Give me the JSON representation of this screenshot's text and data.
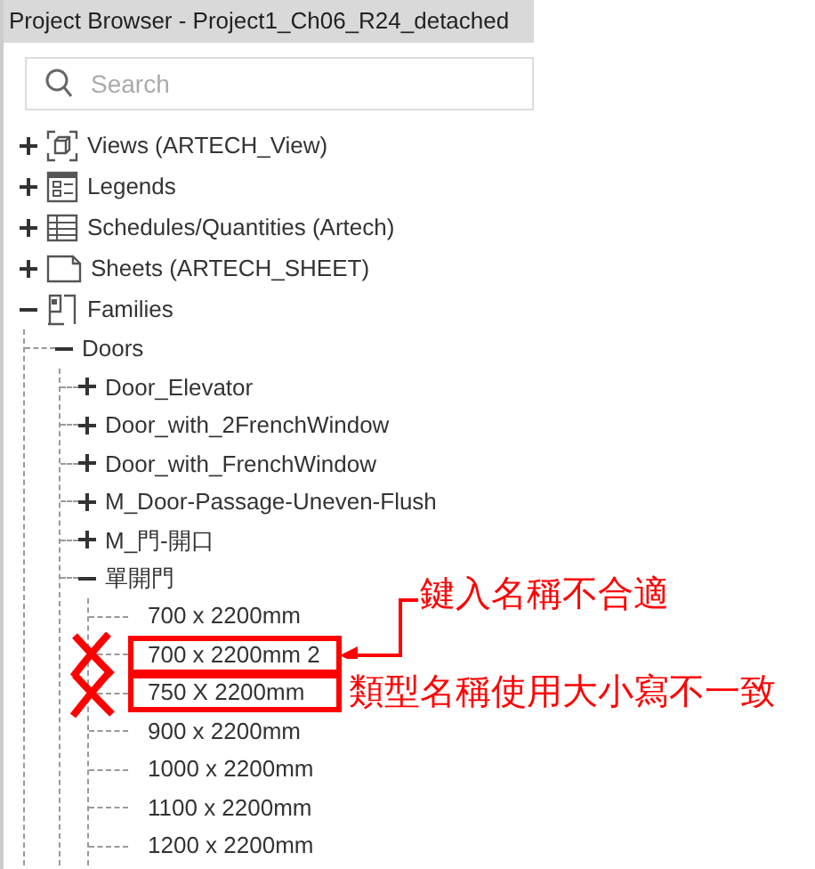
{
  "window": {
    "title": "Project Browser - Project1_Ch06_R24_detached"
  },
  "search": {
    "placeholder": "Search"
  },
  "tree": [
    {
      "label": "Views (ARTECH_View)",
      "kind": "views",
      "expanded": false
    },
    {
      "label": "Legends",
      "kind": "legends",
      "expanded": false
    },
    {
      "label": "Schedules/Quantities (Artech)",
      "kind": "schedules",
      "expanded": false
    },
    {
      "label": "Sheets (ARTECH_SHEET)",
      "kind": "sheets",
      "expanded": false
    },
    {
      "label": "Families",
      "kind": "families",
      "expanded": true,
      "children": [
        {
          "label": "Doors",
          "expanded": true,
          "children": [
            {
              "label": "Door_Elevator",
              "expanded": false
            },
            {
              "label": "Door_with_2FrenchWindow",
              "expanded": false
            },
            {
              "label": "Door_with_FrenchWindow",
              "expanded": false
            },
            {
              "label": "M_Door-Passage-Uneven-Flush",
              "expanded": false
            },
            {
              "label": "M_門-開口",
              "expanded": false
            },
            {
              "label": "單開門",
              "expanded": true,
              "children": [
                {
                  "label": "700 x 2200mm",
                  "flagged": false
                },
                {
                  "label": "700 x 2200mm 2",
                  "flagged": true,
                  "note": {
                    "text": "鍵入名稱不合適",
                    "kind": "arrow"
                  }
                },
                {
                  "label": "750 X 2200mm",
                  "flagged": true,
                  "note": {
                    "text": "類型名稱使用大小寫不一致",
                    "kind": "plain"
                  }
                },
                {
                  "label": "900 x 2200mm",
                  "flagged": false
                },
                {
                  "label": "1000 x 2200mm",
                  "flagged": false
                },
                {
                  "label": "1100 x 2200mm",
                  "flagged": false
                },
                {
                  "label": "1200 x 2200mm",
                  "flagged": false
                }
              ]
            }
          ]
        }
      ]
    }
  ]
}
